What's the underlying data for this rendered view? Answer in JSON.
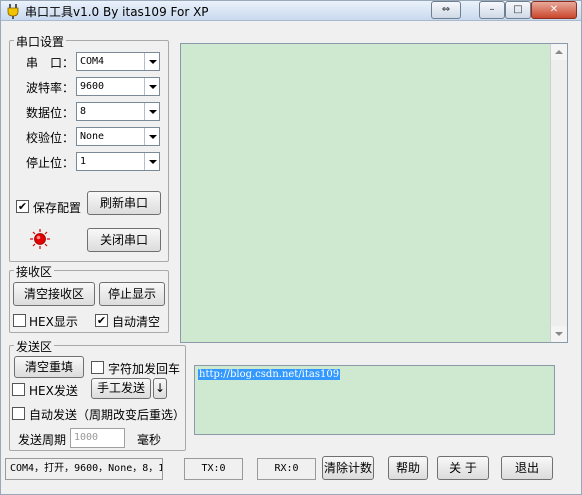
{
  "window": {
    "title": "串口工具v1.0 By itas109 For XP",
    "icon": "plug-icon"
  },
  "serial_settings": {
    "group_label": "串口设置",
    "port": {
      "label": "串　口：",
      "value": "COM4"
    },
    "baud": {
      "label": "波特率：",
      "value": "9600"
    },
    "data_bits": {
      "label": "数据位：",
      "value": "8"
    },
    "parity": {
      "label": "校验位：",
      "value": "None"
    },
    "stop_bits": {
      "label": "停止位：",
      "value": "1"
    },
    "save_config": {
      "label": "保存配置",
      "checked": true
    },
    "refresh_label": "刷新串口",
    "close_port_label": "关闭串口",
    "status_led_color": "#e00000"
  },
  "receive": {
    "group_label": "接收区",
    "clear_label": "清空接收区",
    "stop_label": "停止显示",
    "hex_display": {
      "label": "HEX显示",
      "checked": false
    },
    "auto_clear": {
      "label": "自动清空",
      "checked": true
    }
  },
  "send": {
    "group_label": "发送区",
    "clear_label": "清空重填",
    "append_cr": {
      "label": "字符加发回车",
      "checked": false
    },
    "hex_send": {
      "label": "HEX发送",
      "checked": false
    },
    "manual_send_label": "手工发送",
    "send_arrow": "↓",
    "auto_send": {
      "label": "自动发送（周期改变后重选）",
      "checked": false
    },
    "period_label": "发送周期",
    "period_value": "1000",
    "period_unit": "毫秒",
    "text": "http://blog.csdn.net/itas109"
  },
  "statusbar": {
    "port_status": "COM4，打开，9600，None，8，1",
    "tx": "TX:0",
    "rx": "RX:0",
    "clear_count_label": "清除计数",
    "help_label": "帮助",
    "about_label": "关 于",
    "exit_label": "退出"
  }
}
